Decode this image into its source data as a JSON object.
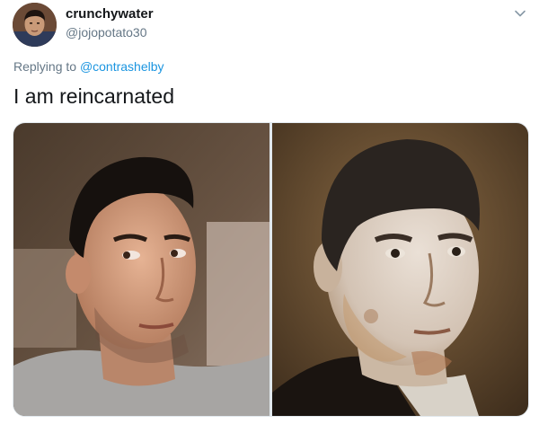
{
  "tweet": {
    "author": {
      "display_name": "crunchywater",
      "handle": "@jojopotato30",
      "avatar_icon": "profile-photo"
    },
    "reply": {
      "prefix": "Replying to ",
      "mention": "@contrashelby"
    },
    "text": "I am reincarnated",
    "menu_icon": "chevron-down-icon",
    "media": [
      {
        "kind": "photo",
        "subject": "selfie"
      },
      {
        "kind": "photo",
        "subject": "painted portrait"
      }
    ]
  },
  "colors": {
    "text": "#14171a",
    "muted": "#657786",
    "link": "#1b95e0",
    "border": "#e1e8ed"
  }
}
